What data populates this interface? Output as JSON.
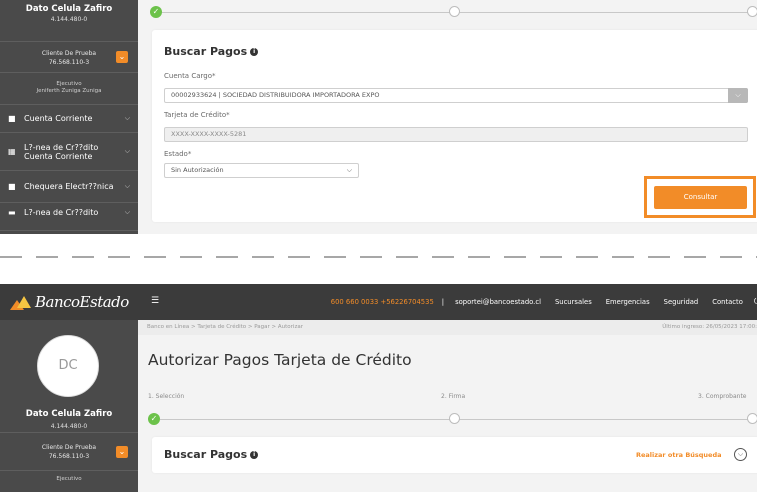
{
  "top_panel": {
    "sidebar": {
      "user_name": "Dato Celula Zafiro",
      "user_id": "4.144.480-0",
      "client_label": "Cliente De Prueba",
      "client_id": "76.568.110-3",
      "executive_title": "Ejecutivo",
      "executive_name": "Jeniferth Zuniga Zuniga",
      "menu_items": [
        {
          "label": "Cuenta Corriente",
          "icon": "briefcase-icon"
        },
        {
          "label": "L?-nea de Cr??dito Cuenta Corriente",
          "icon": "grid-icon"
        },
        {
          "label": "Chequera Electr??nica",
          "icon": "briefcase-icon"
        },
        {
          "label": "L?-nea de Cr??dito",
          "icon": "dash-icon"
        }
      ]
    },
    "card": {
      "title": "Buscar Pagos",
      "cuenta_cargo_label": "Cuenta Cargo*",
      "cuenta_cargo_value": "00002933624 | SOCIEDAD DISTRIBUIDORA IMPORTADORA EXPO",
      "tarjeta_label": "Tarjeta de Crédito*",
      "tarjeta_value": "XXXX-XXXX-XXXX-5281",
      "estado_label": "Estado*",
      "estado_value": "Sin Autorización",
      "consultar_label": "Consultar"
    }
  },
  "bottom_panel": {
    "brand": "BancoEstado",
    "header": {
      "phone": "600 660 0033 +56226704535",
      "email": "soportei@bancoestado.cl",
      "links": [
        "Sucursales",
        "Emergencias",
        "Seguridad",
        "Contacto"
      ]
    },
    "sidebar": {
      "avatar_initials": "DC",
      "user_name": "Dato Celula Zafiro",
      "user_id": "4.144.480-0",
      "client_label": "Cliente De Prueba",
      "client_id": "76.568.110-3",
      "executive_title": "Ejecutivo"
    },
    "breadcrumb": "Banco en Línea > Tarjeta de Crédito > Pagar > Autorizar",
    "last_login": "Último ingreso: 26/05/2023 17:00:",
    "page_title": "Autorizar Pagos Tarjeta de Crédito",
    "steps": [
      "1. Selección",
      "2. Firma",
      "3. Comprobante"
    ],
    "card_title": "Buscar Pagos",
    "realizar_label": "Realizar otra Búsqueda"
  },
  "colors": {
    "accent": "#f28c28",
    "sidebar": "#4a4a4a",
    "topbar": "#3b3b3b",
    "step_done": "#6cc24a"
  }
}
